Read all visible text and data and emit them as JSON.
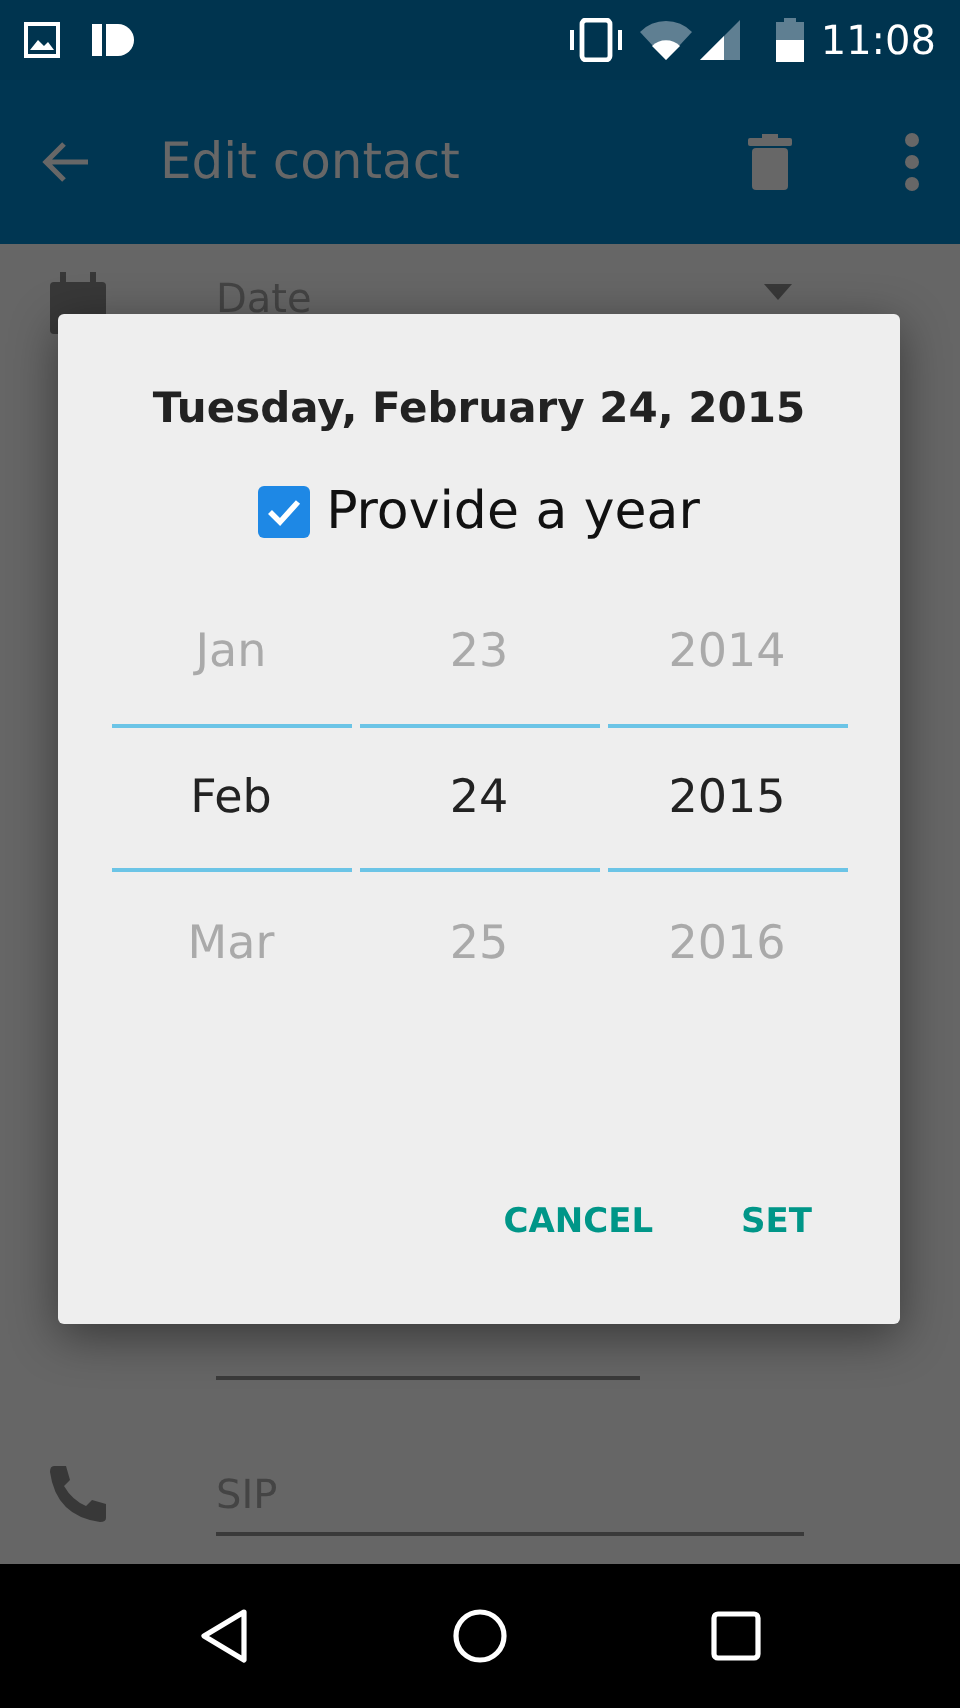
{
  "status_bar": {
    "time": "11:08"
  },
  "app_bar": {
    "title": "Edit contact"
  },
  "fields": [
    {
      "kind": "date",
      "placeholder": "Date"
    },
    {
      "kind": "blank"
    },
    {
      "kind": "sip",
      "placeholder": "SIP"
    }
  ],
  "dialog": {
    "header": "Tuesday, February 24, 2015",
    "year_checkbox": {
      "label": "Provide a year",
      "checked": true
    },
    "pickers": [
      {
        "previous": "Jan",
        "current": "Feb",
        "next": "Mar"
      },
      {
        "previous": "23",
        "current": "24",
        "next": "25"
      },
      {
        "previous": "2014",
        "current": "2015",
        "next": "2016"
      }
    ],
    "buttons": [
      "CANCEL",
      "SET"
    ]
  }
}
